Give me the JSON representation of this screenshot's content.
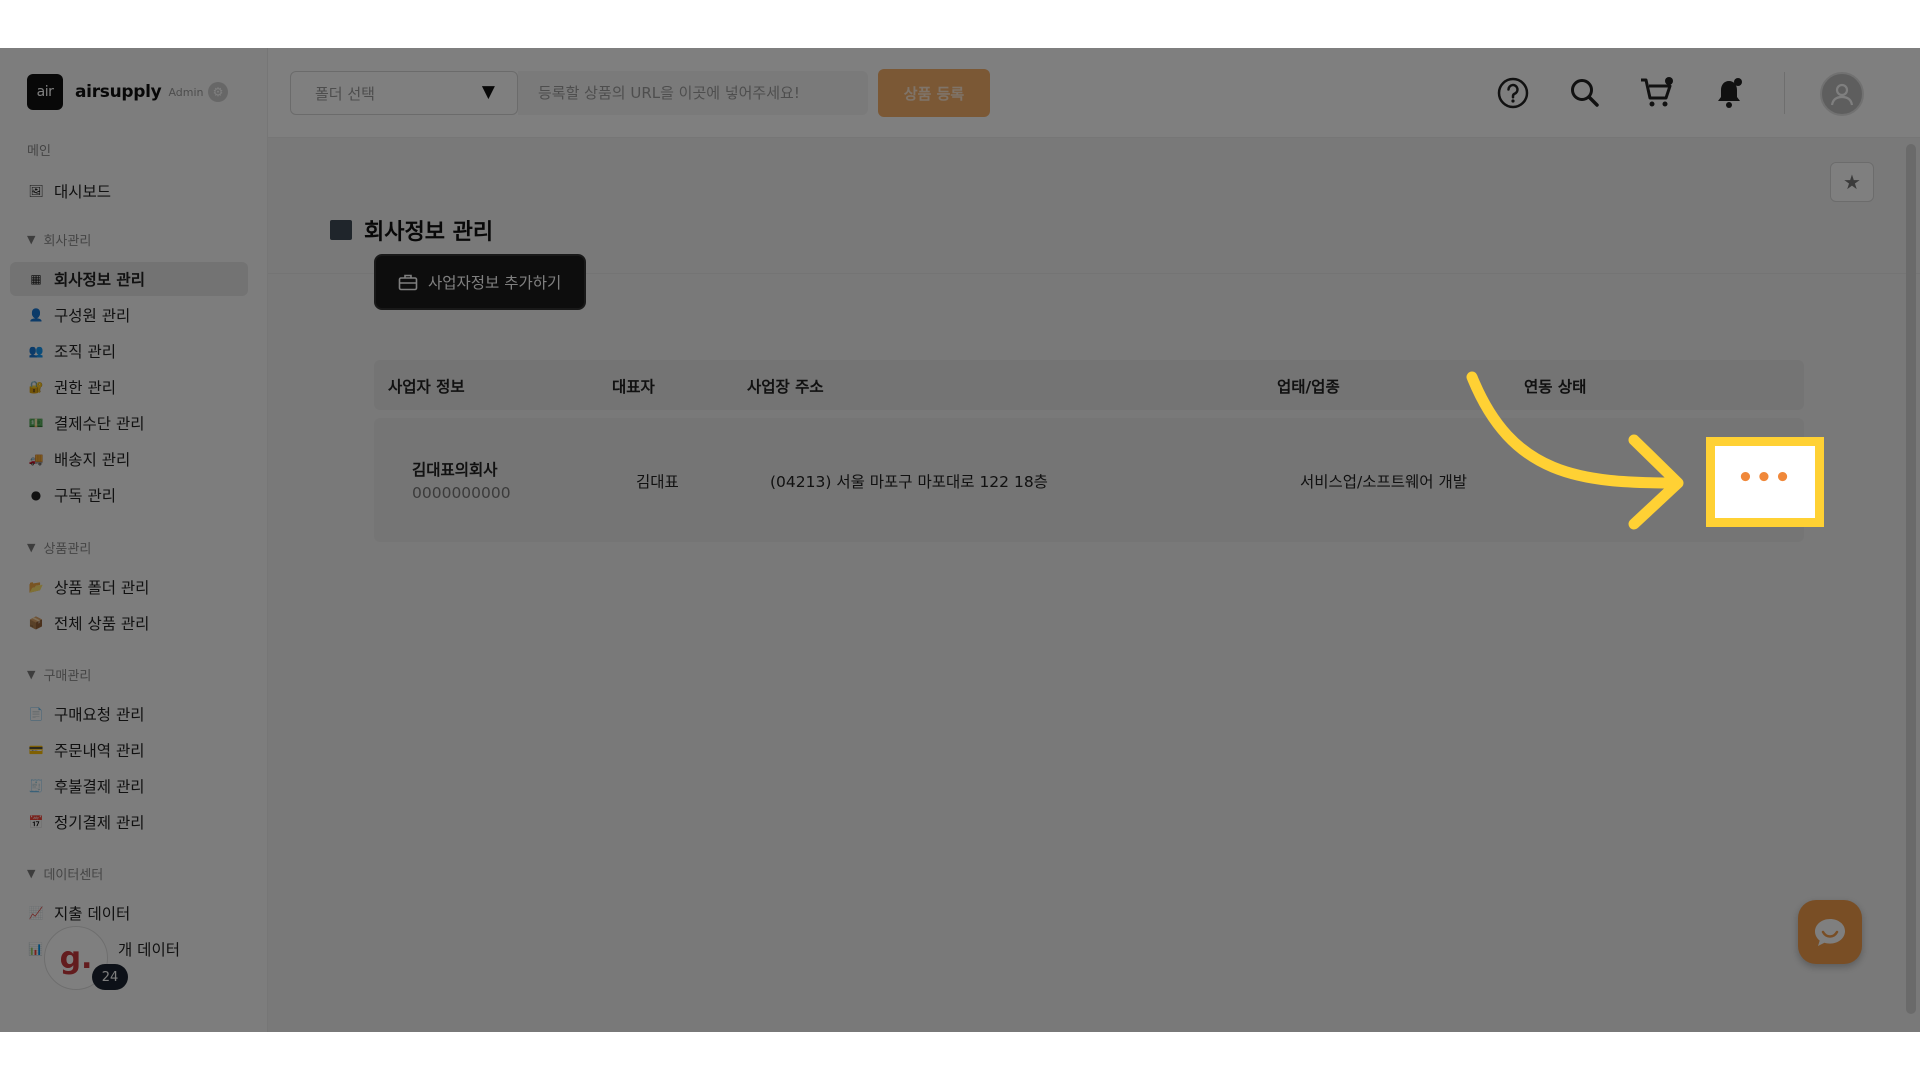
{
  "brand": {
    "logo": "air",
    "name": "airsupply",
    "role": "Admin"
  },
  "sidebar": {
    "main_section": "메인",
    "dashboard": "대시보드",
    "sections": {
      "company": "회사관리",
      "products": "상품관리",
      "purchase": "구매관리",
      "data": "데이터센터"
    },
    "company_items": [
      "회사정보 관리",
      "구성원 관리",
      "조직 관리",
      "권한 관리",
      "결제수단 관리",
      "배송지 관리",
      "구독 관리"
    ],
    "product_items": [
      "상품 폴더 관리",
      "전체 상품 관리"
    ],
    "purchase_items": [
      "구매요청 관리",
      "주문내역 관리",
      "후불결제 관리",
      "정기결제 관리"
    ],
    "data_items": [
      "지출 데이터",
      "개 데이터"
    ]
  },
  "header": {
    "folder_placeholder": "폴더 선택",
    "url_placeholder": "등록할 상품의 URL을 이곳에 넣어주세요!",
    "register_label": "상품 등록"
  },
  "page": {
    "title": "회사정보 관리",
    "add_button": "사업자정보 추가하기"
  },
  "table": {
    "headers": [
      "사업자 정보",
      "대표자",
      "사업장 주소",
      "업태/업종",
      "연동 상태"
    ],
    "rows": [
      {
        "company": "김대표의회사",
        "biz_number": "0000000000",
        "ceo": "김대표",
        "address": "(04213) 서울 마포구 마포대로 122 18층",
        "industry": "서비스업/소프트웨어 개발",
        "status": "",
        "more": "•••"
      }
    ]
  },
  "widgets": {
    "g_letter": "g.",
    "g_count": "24"
  },
  "colors": {
    "accent": "#f39c4a",
    "highlight": "#ffd134",
    "dim_overlay": "rgba(0,0,0,0.5)"
  },
  "icons": [
    "settings-icon",
    "help-icon",
    "search-icon",
    "cart-icon",
    "bell-icon",
    "user-icon",
    "star-icon",
    "briefcase-icon",
    "chat-icon"
  ]
}
